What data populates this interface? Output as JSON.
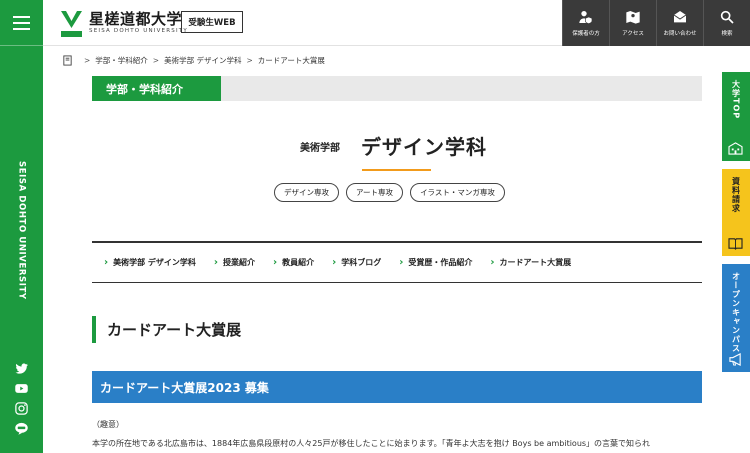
{
  "site": {
    "title": "星槎道都大学",
    "subtitle": "SEISA DOHTO UNIVERSITY",
    "exam_label": "受験生WEB",
    "vertical_name": "SEISA DOHTO UNIVERSITY",
    "brand_green": "#1c9a3f",
    "brand_blue": "#2a7fc7",
    "brand_yellow": "#f5c41c",
    "accent_orange": "#f29b1b"
  },
  "topnav": [
    {
      "label": "保護者の方",
      "icon": "parent-icon"
    },
    {
      "label": "アクセス",
      "icon": "map-icon"
    },
    {
      "label": "お問い合わせ",
      "icon": "mail-icon"
    },
    {
      "label": "検索",
      "icon": "search-icon"
    }
  ],
  "side_tabs": {
    "top": "大学TOP",
    "request": "資料請求",
    "open_campus": "オープンキャンパス"
  },
  "breadcrumb": [
    "学部・学科紹介",
    "美術学部 デザイン学科",
    "カードアート大賞展"
  ],
  "section_label": "学部・学科紹介",
  "faculty": "美術学部",
  "department": "デザイン学科",
  "courses": [
    "デザイン専攻",
    "アート専攻",
    "イラスト・マンガ専攻"
  ],
  "subnav": [
    "美術学部 デザイン学科",
    "授業紹介",
    "教員紹介",
    "学科ブログ",
    "受賞歴・作品紹介",
    "カードアート大賞展"
  ],
  "page_heading": "カードアート大賞展",
  "banner": "カードアート大賞展2023 募集",
  "purpose_label": "（趣意）",
  "body_text": "本学の所在地である北広島市は、1884年広島県段原村の人々25戸が移住したことに始まります。「青年よ大志を抱け Boys be ambitious」の言葉で知られ"
}
